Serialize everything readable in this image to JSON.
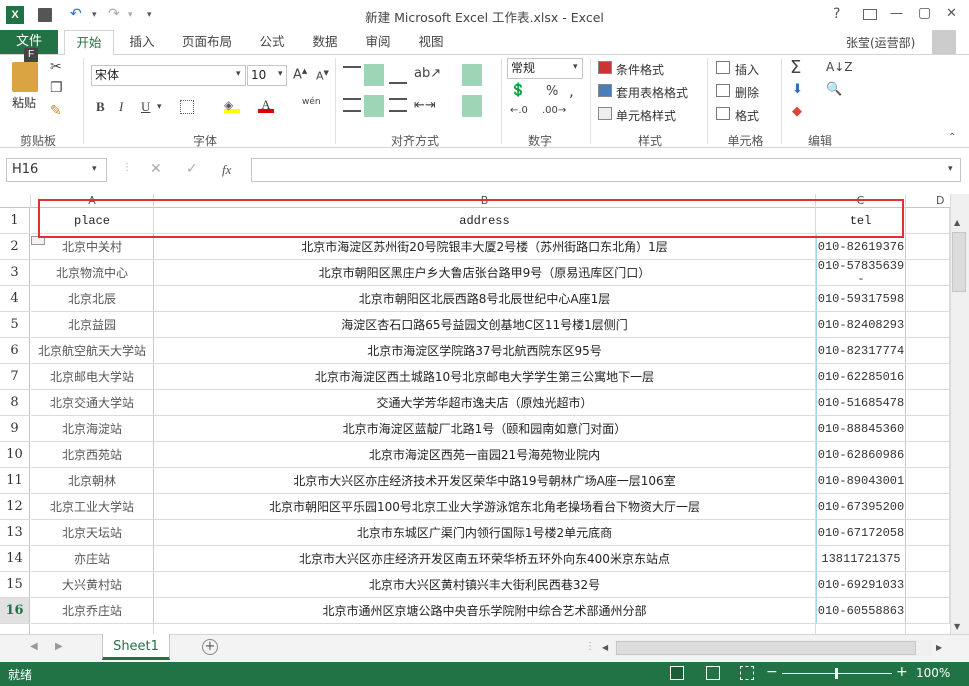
{
  "window": {
    "title": "新建 Microsoft Excel 工作表.xlsx - Excel",
    "help": "?",
    "user": "张莹(运营部)",
    "min": "—",
    "restore": "▢",
    "close": "✕"
  },
  "qat": {
    "file_key": "F"
  },
  "tabs": [
    "文件",
    "开始",
    "插入",
    "页面布局",
    "公式",
    "数据",
    "审阅",
    "视图"
  ],
  "ribbon": {
    "clipboard": {
      "paste": "粘贴",
      "label": "剪贴板"
    },
    "font": {
      "name": "宋体",
      "size": "10",
      "label": "字体",
      "bold": "B",
      "italic": "I",
      "underline": "U",
      "wen": "wén"
    },
    "alignment": {
      "label": "对齐方式"
    },
    "number": {
      "format": "常规",
      "percent": "%",
      "comma": ",",
      "label": "数字"
    },
    "styles": {
      "cond": "条件格式",
      "table": "套用表格格式",
      "cell": "单元格样式",
      "label": "样式"
    },
    "cells": {
      "insert": "插入",
      "delete": "删除",
      "format": "格式",
      "label": "单元格"
    },
    "editing": {
      "label": "编辑"
    }
  },
  "formula_bar": {
    "name_box": "H16",
    "fx": "fx",
    "value": ""
  },
  "columns": [
    "A",
    "B",
    "C",
    "D"
  ],
  "header_row": {
    "num": "1",
    "place": "place",
    "address": "address",
    "tel": "tel"
  },
  "rows": [
    {
      "num": "2",
      "place": "北京中关村",
      "address": "北京市海淀区苏州街20号院银丰大厦2号楼（苏州街路口东北角）1层",
      "tel": "010-82619376"
    },
    {
      "num": "3",
      "place": "北京物流中心",
      "address": "北京市朝阳区黑庄户乡大鲁店张台路甲9号（原易迅库区门口）",
      "tel": "010-57835639-"
    },
    {
      "num": "4",
      "place": "北京北辰",
      "address": "北京市朝阳区北辰西路8号北辰世纪中心A座1层",
      "tel": "010-59317598"
    },
    {
      "num": "5",
      "place": "北京益园",
      "address": "海淀区杏石口路65号益园文创基地C区11号楼1层侧门",
      "tel": "010-82408293"
    },
    {
      "num": "6",
      "place": "北京航空航天大学站",
      "address": "北京市海淀区学院路37号北航西院东区95号",
      "tel": "010-82317774"
    },
    {
      "num": "7",
      "place": "北京邮电大学站",
      "address": "北京市海淀区西土城路10号北京邮电大学学生第三公寓地下一层",
      "tel": "010-62285016"
    },
    {
      "num": "8",
      "place": "北京交通大学站",
      "address": "交通大学芳华超市逸夫店（原烛光超市）",
      "tel": "010-51685478"
    },
    {
      "num": "9",
      "place": "北京海淀站",
      "address": "北京市海淀区蓝靛厂北路1号（颐和园南如意门对面）",
      "tel": "010-88845360"
    },
    {
      "num": "10",
      "place": "北京西苑站",
      "address": "北京市海淀区西苑一亩园21号海苑物业院内",
      "tel": "010-62860986"
    },
    {
      "num": "11",
      "place": "北京朝林",
      "address": "北京市大兴区亦庄经济技术开发区荣华中路19号朝林广场A座一层106室",
      "tel": "010-89043001"
    },
    {
      "num": "12",
      "place": "北京工业大学站",
      "address": "北京市朝阳区平乐园100号北京工业大学游泳馆东北角老操场看台下物资大厅一层",
      "tel": "010-67395200"
    },
    {
      "num": "13",
      "place": "北京天坛站",
      "address": "北京市东城区广渠门内领行国际1号楼2单元底商",
      "tel": "010-67172058"
    },
    {
      "num": "14",
      "place": "亦庄站",
      "address": "北京市大兴区亦庄经济开发区南五环荣华桥五环外向东400米京东站点",
      "tel": "13811721375"
    },
    {
      "num": "15",
      "place": "大兴黄村站",
      "address": "北京市大兴区黄村镇兴丰大街利民西巷32号",
      "tel": "010-69291033"
    },
    {
      "num": "16",
      "place": "北京乔庄站",
      "address": "北京市通州区京塘公路中央音乐学院附中综合艺术部通州分部",
      "tel": "010-60558863"
    }
  ],
  "sheet": {
    "name": "Sheet1",
    "add": "+"
  },
  "status": {
    "ready": "就绪",
    "zoom": "100%",
    "minus": "−",
    "plus": "+"
  },
  "colors": {
    "accent": "#217346",
    "highlight": "#e03030"
  }
}
